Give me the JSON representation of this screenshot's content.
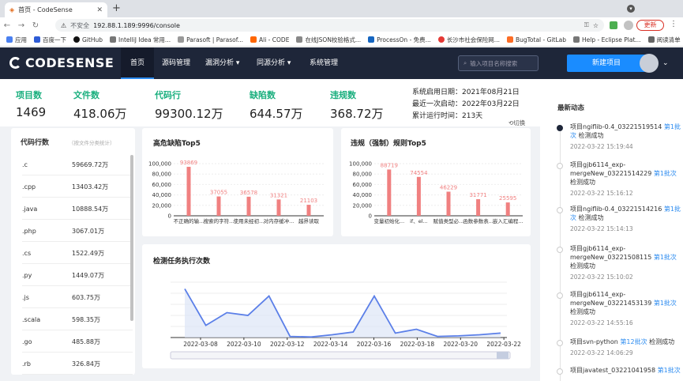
{
  "browser": {
    "tab_title": "首页 - CodeSense",
    "insecure_label": "不安全",
    "url": "192.88.1.189:9996/console",
    "update_label": "更新",
    "bookmarks": [
      "应用",
      "百度一下",
      "GitHub",
      "IntelliJ Idea 常用...",
      "Parasoft | Parasof...",
      "Ali - CODE",
      "在线JSON校验格式...",
      "ProcessOn - 免费...",
      "长沙市社会保险网...",
      "BugTotal - GitLab",
      "Help - Eclipse Plat..."
    ],
    "reading_list": "阅读清单"
  },
  "app": {
    "logo": "CODESENSE",
    "nav": [
      "首页",
      "源码管理",
      "漏洞分析",
      "同源分析",
      "系统管理"
    ],
    "search_placeholder": "输入项目名称搜索",
    "new_project": "新建项目"
  },
  "stats": [
    {
      "label": "项目数",
      "value": "1469"
    },
    {
      "label": "文件数",
      "value": "418.06万"
    },
    {
      "label": "代码行",
      "value": "99300.12万"
    },
    {
      "label": "缺陷数",
      "value": "644.57万"
    },
    {
      "label": "违规数",
      "value": "368.72万"
    }
  ],
  "sysinfo": {
    "start_date": "系统启用日期：2021年08月21日",
    "last_start": "最近一次启动：2022年03月22日",
    "uptime": "累计运行时间：213天",
    "switch": "切换"
  },
  "code_lines": {
    "title": "代码行数",
    "subtitle": "（按文件分类统计）",
    "rows": [
      {
        "ext": ".c",
        "value": "59669.72万"
      },
      {
        "ext": ".cpp",
        "value": "13403.42万"
      },
      {
        "ext": ".java",
        "value": "10888.54万"
      },
      {
        "ext": ".php",
        "value": "3067.01万"
      },
      {
        "ext": ".cs",
        "value": "1522.49万"
      },
      {
        "ext": ".py",
        "value": "1449.07万"
      },
      {
        "ext": ".js",
        "value": "603.75万"
      },
      {
        "ext": ".scala",
        "value": "598.35万"
      },
      {
        "ext": ".go",
        "value": "485.88万"
      },
      {
        "ext": ".rb",
        "value": "326.84万"
      }
    ]
  },
  "news": {
    "title": "最新动态",
    "items": [
      {
        "pre": "项目ngiflib-0.4_03221519514 ",
        "link": "第1批次",
        "post": " 检测成功",
        "time": "2022-03-22 15:19:44"
      },
      {
        "pre": "项目gjb6114_exp-mergeNew_03221514229 ",
        "link": "第1批次",
        "post": " 检测成功",
        "time": "2022-03-22 15:16:12"
      },
      {
        "pre": "项目ngiflib-0.4_03221514216 ",
        "link": "第1批次",
        "post": " 检测成功",
        "time": "2022-03-22 15:14:13"
      },
      {
        "pre": "项目gjb6114_exp-mergeNew_03221508115 ",
        "link": "第1批次",
        "post": " 检测成功",
        "time": "2022-03-22 15:10:02"
      },
      {
        "pre": "项目gjb6114_exp-mergeNew_03221453139 ",
        "link": "第1批次",
        "post": " 检测成功",
        "time": "2022-03-22 14:55:16"
      },
      {
        "pre": "项目svn-python ",
        "link": "第12批次",
        "post": " 检测成功",
        "time": "2022-03-22 14:06:29"
      },
      {
        "pre": "项目javatest_03221041958 ",
        "link": "第1批次",
        "post": "",
        "time": ""
      }
    ]
  },
  "chart_data": [
    {
      "type": "bar",
      "title": "高危缺陷Top5",
      "categories": [
        "不正确的输...",
        "搜索的字符...",
        "使用未经初...",
        "对内存缓冲...",
        "越界读取"
      ],
      "values": [
        93869,
        37055,
        36578,
        31321,
        21103
      ],
      "ylim": [
        0,
        100000
      ],
      "yticks": [
        "0",
        "20,000",
        "40,000",
        "60,000",
        "80,000",
        "100,000"
      ],
      "color": "#f08080"
    },
    {
      "type": "bar",
      "title": "违规（强制）规则Top5",
      "categories": [
        "变量初始化...",
        "if、el...",
        "赋值类型必...",
        "函数参数表...",
        "嵌入汇编程..."
      ],
      "values": [
        88719,
        74554,
        46229,
        31771,
        25595
      ],
      "ylim": [
        0,
        100000
      ],
      "yticks": [
        "0",
        "20,000",
        "40,000",
        "60,000",
        "80,000",
        "100,000"
      ],
      "color": "#f08080"
    },
    {
      "type": "area",
      "title": "检测任务执行次数",
      "xticks": [
        "2022-03-08",
        "2022-03-10",
        "2022-03-12",
        "2022-03-14",
        "2022-03-16",
        "2022-03-18",
        "2022-03-20",
        "2022-03-22"
      ],
      "values": [
        88,
        22,
        45,
        40,
        75,
        2,
        1,
        5,
        10,
        75,
        8,
        15,
        2,
        3,
        5,
        8
      ],
      "ylim": [
        0,
        100
      ],
      "color": "#5b7fe8"
    }
  ]
}
